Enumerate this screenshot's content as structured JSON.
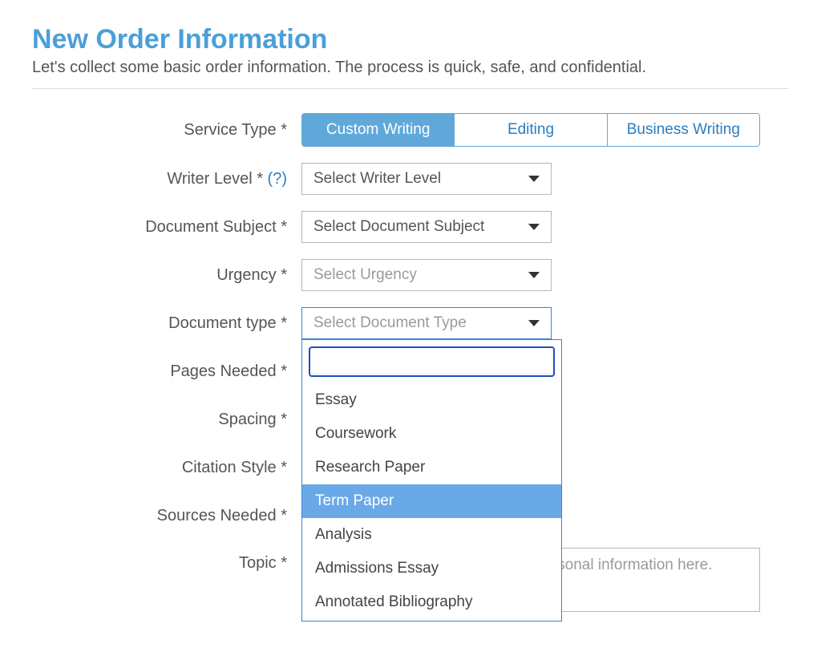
{
  "header": {
    "title": "New Order Information",
    "subtitle": "Let's collect some basic order information. The process is quick, safe, and confidential."
  },
  "labels": {
    "service_type": "Service Type *",
    "writer_level": "Writer Level *",
    "writer_level_help": "(?)",
    "document_subject": "Document Subject *",
    "urgency": "Urgency *",
    "document_type": "Document type *",
    "pages_needed": "Pages Needed *",
    "spacing": "Spacing *",
    "citation_style": "Citation Style *",
    "sources_needed": "Sources Needed *",
    "topic": "Topic *"
  },
  "service_type": {
    "options": [
      {
        "label": "Custom Writing",
        "active": true
      },
      {
        "label": "Editing",
        "active": false
      },
      {
        "label": "Business Writing",
        "active": false
      }
    ]
  },
  "selects": {
    "writer_level": {
      "value": "Select Writer Level",
      "placeholder": false
    },
    "document_subject": {
      "value": "Select Document Subject",
      "placeholder": false
    },
    "urgency": {
      "value": "Select Urgency",
      "placeholder": true
    },
    "document_type": {
      "value": "Select Document Type",
      "placeholder": true,
      "open": true
    }
  },
  "document_type_dropdown": {
    "search_value": "",
    "options": [
      {
        "label": "Essay",
        "highlighted": false
      },
      {
        "label": "Coursework",
        "highlighted": false
      },
      {
        "label": "Research Paper",
        "highlighted": false
      },
      {
        "label": "Term Paper",
        "highlighted": true
      },
      {
        "label": "Analysis",
        "highlighted": false
      },
      {
        "label": "Admissions Essay",
        "highlighted": false
      },
      {
        "label": "Annotated Bibliography",
        "highlighted": false
      }
    ]
  },
  "topic": {
    "placeholder": "Topic of your order. Do not enter personal information here.",
    "value": ""
  }
}
